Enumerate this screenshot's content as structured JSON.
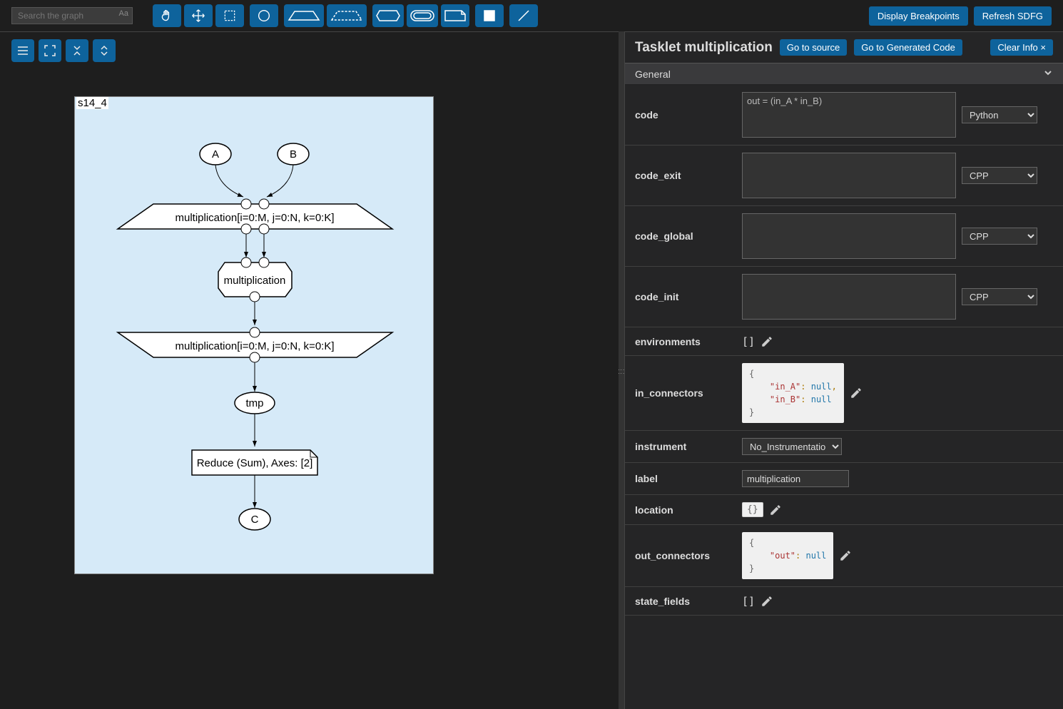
{
  "search": {
    "placeholder": "Search the graph"
  },
  "top_buttons": {
    "breakpoints": "Display Breakpoints",
    "refresh": "Refresh SDFG"
  },
  "graph": {
    "state_label": "s14_4",
    "nodes": {
      "A": "A",
      "B": "B",
      "map_entry": "multiplication[i=0:M, j=0:N, k=0:K]",
      "tasklet": "multiplication",
      "map_exit": "multiplication[i=0:M, j=0:N, k=0:K]",
      "tmp": "tmp",
      "reduce": "Reduce (Sum), Axes: [2]",
      "C": "C"
    }
  },
  "panel": {
    "title": "Tasklet multiplication",
    "go_source": "Go to source",
    "go_generated": "Go to Generated Code",
    "clear": "Clear Info ×",
    "section": "General",
    "props": {
      "code_label": "code",
      "code_value": "out = (in_A * in_B)",
      "code_lang": "Python",
      "code_exit_label": "code_exit",
      "code_exit_lang": "CPP",
      "code_global_label": "code_global",
      "code_global_lang": "CPP",
      "code_init_label": "code_init",
      "code_init_lang": "CPP",
      "environments_label": "environments",
      "environments_value": "[]",
      "in_connectors_label": "in_connectors",
      "instrument_label": "instrument",
      "instrument_value": "No_Instrumentation",
      "label_label": "label",
      "label_value": "multiplication",
      "location_label": "location",
      "location_value": "{}",
      "out_connectors_label": "out_connectors",
      "state_fields_label": "state_fields",
      "state_fields_value": "[]"
    }
  }
}
